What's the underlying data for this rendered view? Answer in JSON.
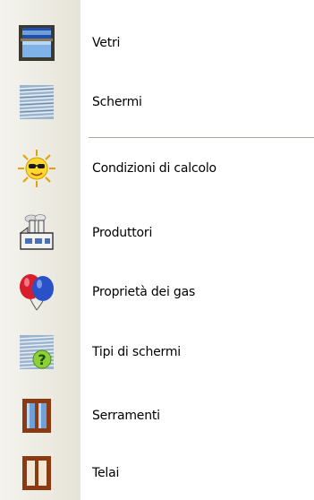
{
  "menu": {
    "items": [
      {
        "label": "Vetri",
        "icon": "window-glass-icon"
      },
      {
        "label": "Schermi",
        "icon": "screen-blinds-icon"
      },
      {
        "label": "Condizioni di calcolo",
        "icon": "sun-sunglasses-icon"
      },
      {
        "label": "Produttori",
        "icon": "factory-icon"
      },
      {
        "label": "Proprietà dei gas",
        "icon": "balloons-icon"
      },
      {
        "label": "Tipi di schermi",
        "icon": "screen-question-icon"
      },
      {
        "label": "Serramenti",
        "icon": "window-frame-icon"
      },
      {
        "label": "Telai",
        "icon": "frame-icon"
      }
    ]
  },
  "colors": {
    "gutter": "#e6e4d8",
    "separator": "#aca899",
    "frame_wood": "#8b3a12",
    "glass_blue": "#6fa0d8"
  }
}
